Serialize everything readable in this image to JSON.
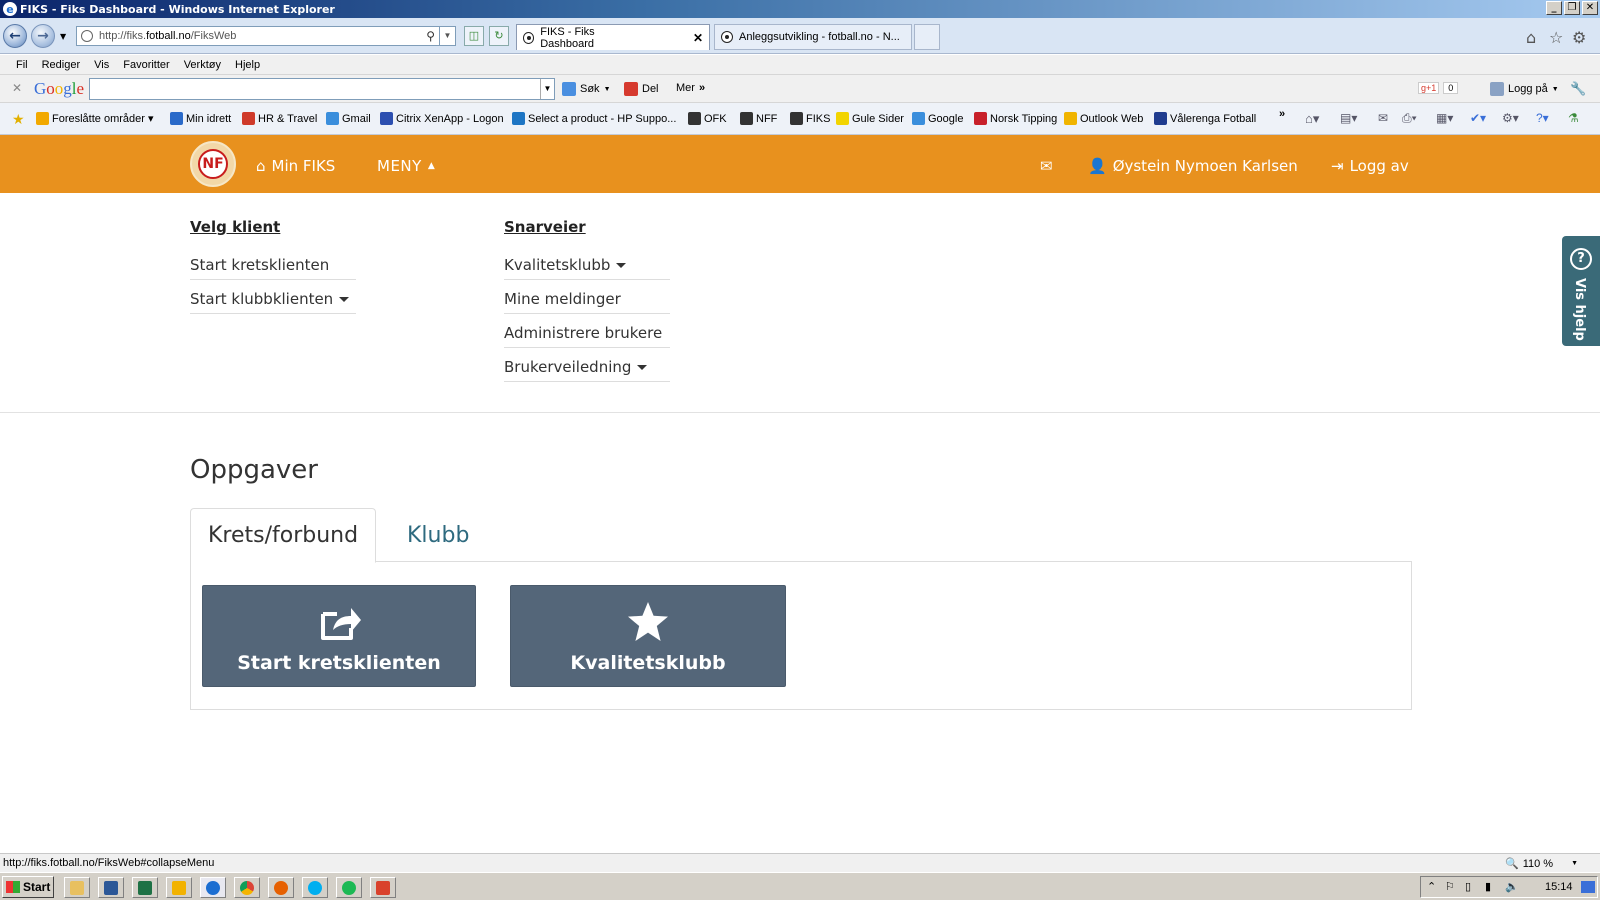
{
  "window": {
    "title": "FIKS - Fiks Dashboard - Windows Internet Explorer",
    "controls": [
      "_",
      "❐",
      "✕"
    ]
  },
  "browser": {
    "address_url_prefix": "http://fiks.",
    "address_url_domain": "fotball.no",
    "address_url_path": "/FiksWeb",
    "tabs": [
      {
        "label": "FIKS - Fiks Dashboard",
        "active": true
      },
      {
        "label": "Anleggsutvikling - fotball.no - N...",
        "active": false
      }
    ],
    "close_tab": "✕"
  },
  "menubar": {
    "items": [
      "Fil",
      "Rediger",
      "Vis",
      "Favoritter",
      "Verktøy",
      "Hjelp"
    ]
  },
  "google_toolbar": {
    "logo": "Google",
    "search_value": "",
    "search_label": "Søk",
    "share_label": "Del",
    "more_label": "Mer",
    "plusone_label": "g+1",
    "plusone_count": "0",
    "login_label": "Logg på"
  },
  "favorites": {
    "items": [
      {
        "label": "Foreslåtte områder",
        "color": "#f2a900"
      },
      {
        "label": "Min idrett",
        "color": "#2a6ac9"
      },
      {
        "label": "HR & Travel",
        "color": "#cf3a2a"
      },
      {
        "label": "Gmail",
        "color": "#3a8edc"
      },
      {
        "label": "Citrix XenApp - Logon",
        "color": "#2c4fb0"
      },
      {
        "label": "Select a product - HP Suppo...",
        "color": "#1d75c4"
      },
      {
        "label": "OFK",
        "color": "#333333"
      },
      {
        "label": "NFF",
        "color": "#333333"
      },
      {
        "label": "FIKS",
        "color": "#333333"
      },
      {
        "label": "Gule Sider",
        "color": "#f2d400"
      },
      {
        "label": "Google",
        "color": "#3a8edc"
      },
      {
        "label": "Norsk Tipping",
        "color": "#c8202a"
      },
      {
        "label": "Outlook Web",
        "color": "#f0b400"
      },
      {
        "label": "Vålerenga Fotball",
        "color": "#1f3c8f"
      }
    ]
  },
  "header": {
    "logo_text": "NF",
    "min_fiks": "Min FIKS",
    "meny": "MENY",
    "user_name": "Øystein Nymoen Karlsen",
    "logout": "Logg av",
    "bg_color": "#e8911e"
  },
  "menu_panel": {
    "velg_klient": {
      "heading": "Velg klient",
      "links": [
        "Start kretsklienten",
        "Start klubbklienten"
      ]
    },
    "snarveier": {
      "heading": "Snarveier",
      "links": [
        "Kvalitetsklubb",
        "Mine meldinger",
        "Administrere brukere",
        "Brukerveiledning"
      ]
    }
  },
  "help_tab": {
    "icon": "?",
    "label": "Vis hjelp"
  },
  "oppgaver": {
    "title": "Oppgaver",
    "tabs": [
      "Krets/forbund",
      "Klubb"
    ],
    "tiles": [
      {
        "label": "Start kretsklienten",
        "icon": "share-icon"
      },
      {
        "label": "Kvalitetsklubb",
        "icon": "star-icon"
      }
    ]
  },
  "statusbar": {
    "text": "http://fiks.fotball.no/FiksWeb#collapseMenu",
    "zoom": "110 %"
  },
  "taskbar": {
    "start": "Start",
    "clock": "15:14"
  }
}
